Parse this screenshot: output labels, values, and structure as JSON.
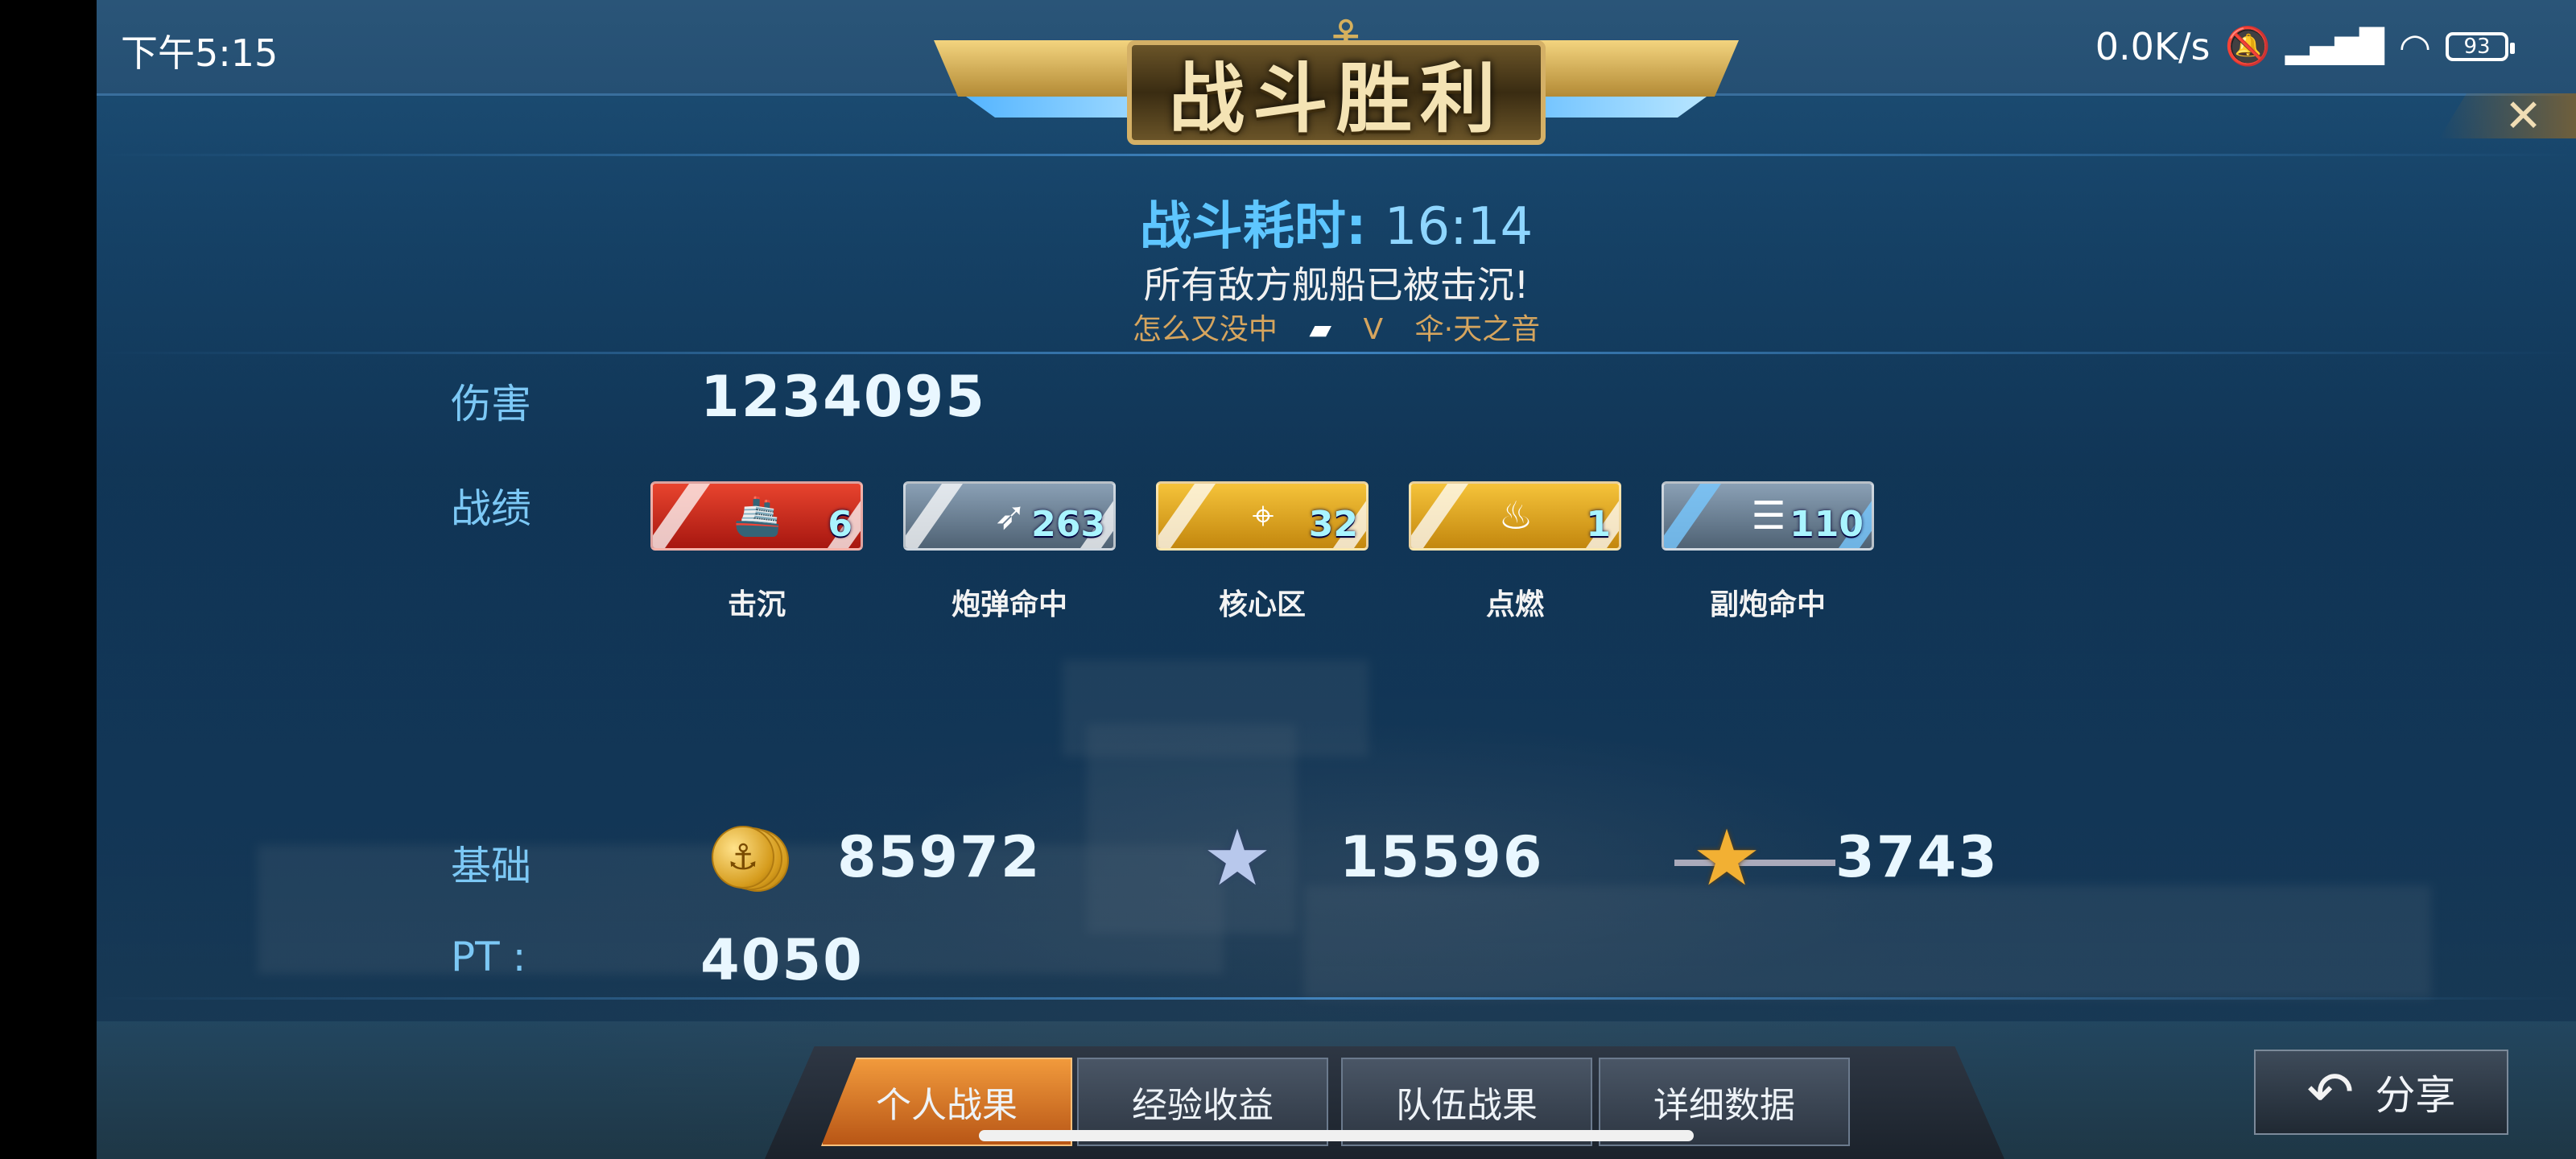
{
  "status_bar": {
    "time": "下午5:15",
    "network_speed": "0.0K/s",
    "battery": "93"
  },
  "banner": {
    "title": "战斗胜利"
  },
  "close": {
    "label": "✕"
  },
  "battle": {
    "time_label": "战斗耗时:",
    "time_value": "16:14",
    "result_text": "所有敌方舰船已被击沉!",
    "player_left": "怎么又没中",
    "versus": "V",
    "player_right": "伞·天之音"
  },
  "damage": {
    "label": "伤害",
    "value": "1234095"
  },
  "record": {
    "label": "战绩",
    "badges": [
      {
        "icon": "sink-ship-icon",
        "count": "6",
        "label": "击沉",
        "color": "#d8261c"
      },
      {
        "icon": "shell-icon",
        "count": "263",
        "label": "炮弹命中",
        "color": "#6f8295"
      },
      {
        "icon": "core-zone-icon",
        "count": "32",
        "label": "核心区",
        "color": "#e0a61a"
      },
      {
        "icon": "fire-icon",
        "count": "1",
        "label": "点燃",
        "color": "#e0a61a"
      },
      {
        "icon": "secondary-gun-icon",
        "count": "110",
        "label": "副炮命中",
        "color": "#6f8295"
      }
    ]
  },
  "base": {
    "label": "基础",
    "gold_value": "85972",
    "silver_star_value": "15596",
    "gold_star_value": "3743"
  },
  "pt": {
    "label": "PT :",
    "value": "4050"
  },
  "tabs": {
    "personal": "个人战果",
    "exp": "经验收益",
    "team": "队伍战果",
    "detail": "详细数据"
  },
  "share": {
    "label": "分享"
  }
}
